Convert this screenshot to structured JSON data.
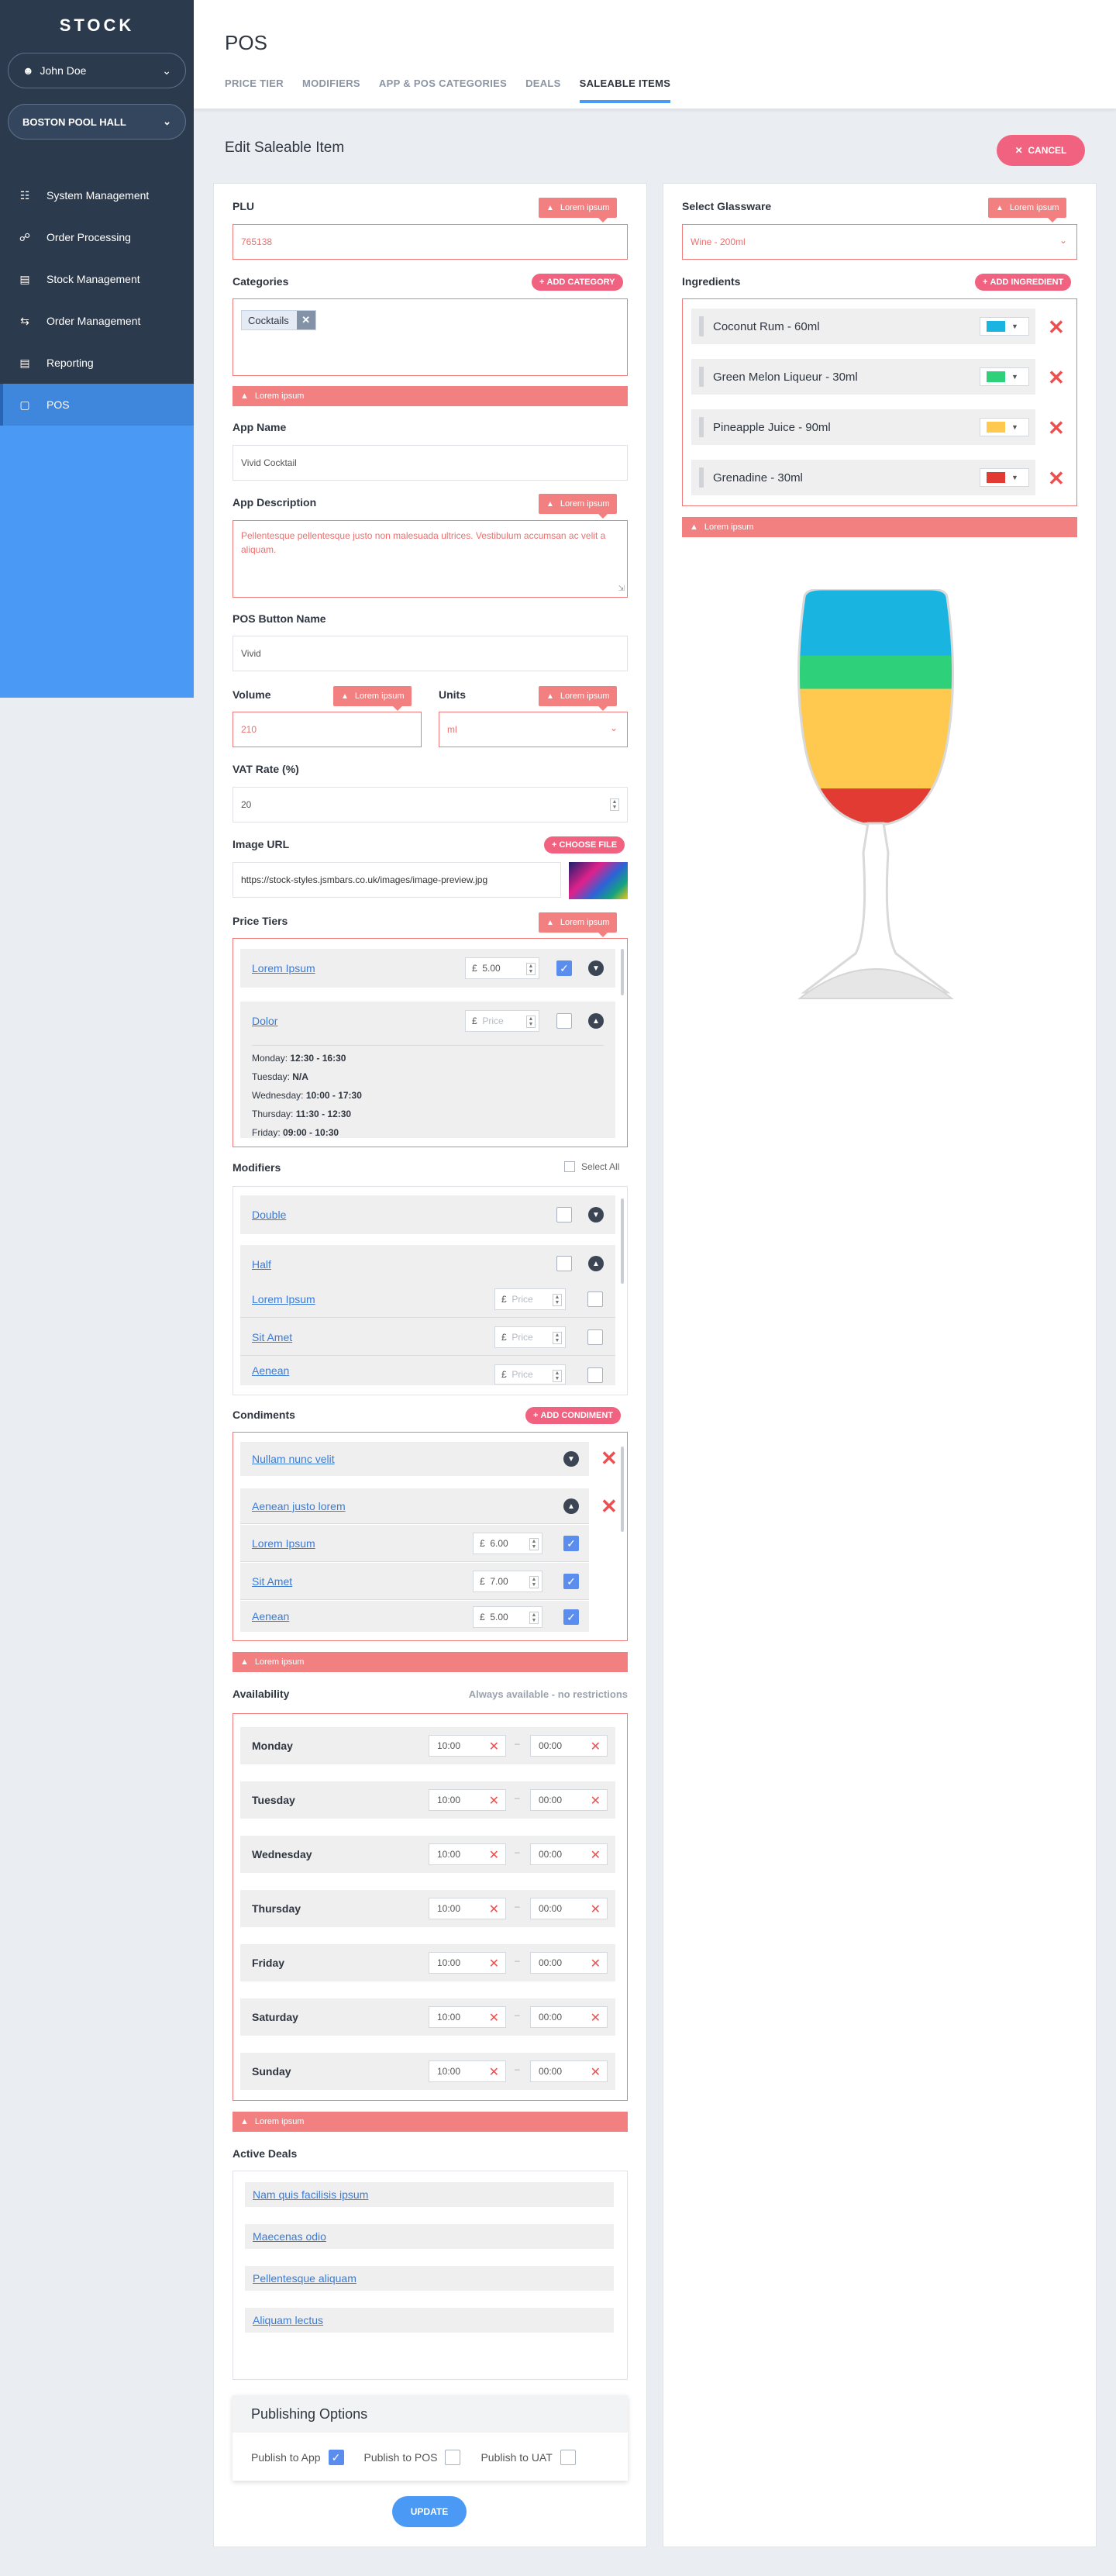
{
  "app": {
    "logo": "STOCK",
    "user": "John Doe",
    "venue": "BOSTON POOL HALL"
  },
  "nav": [
    "System Management",
    "Order Processing",
    "Stock Management",
    "Order Management",
    "Reporting",
    "POS"
  ],
  "header": {
    "title": "POS",
    "tabs": [
      "PRICE TIER",
      "MODIFIERS",
      "APP & POS CATEGORIES",
      "DEALS",
      "SALEABLE ITEMS"
    ]
  },
  "page": {
    "title": "Edit Saleable Item",
    "cancel": "CANCEL",
    "update": "UPDATE"
  },
  "err": "Lorem ipsum",
  "plu": {
    "label": "PLU",
    "value": "765138"
  },
  "categories": {
    "label": "Categories",
    "add": "ADD CATEGORY",
    "chip": "Cocktails"
  },
  "app_name": {
    "label": "App Name",
    "value": "Vivid Cocktail"
  },
  "app_desc": {
    "label": "App Description",
    "value": "Pellentesque pellentesque justo non malesuada ultrices. Vestibulum accumsan ac velit a aliquam."
  },
  "pos_name": {
    "label": "POS Button Name",
    "value": "Vivid"
  },
  "volume": {
    "label": "Volume",
    "value": "210"
  },
  "units": {
    "label": "Units",
    "value": "ml"
  },
  "vat": {
    "label": "VAT Rate (%)",
    "value": "20"
  },
  "image": {
    "label": "Image URL",
    "value": "https://stock-styles.jsmbars.co.uk/images/image-preview.jpg",
    "choose": "CHOOSE FILE"
  },
  "price_tiers": {
    "label": "Price Tiers",
    "rows": [
      {
        "name": "Lorem Ipsum",
        "cur": "£",
        "price": "5.00"
      },
      {
        "name": "Dolor",
        "cur": "£",
        "price": "Price"
      }
    ],
    "schedule": [
      {
        "day": "Monday:",
        "time": "12:30 - 16:30"
      },
      {
        "day": "Tuesday:",
        "time": "N/A"
      },
      {
        "day": "Wednesday:",
        "time": "10:00 - 17:30"
      },
      {
        "day": "Thursday:",
        "time": "11:30 - 12:30"
      },
      {
        "day": "Friday:",
        "time": "09:00 - 10:30"
      }
    ]
  },
  "modifiers": {
    "label": "Modifiers",
    "select_all": "Select All",
    "groups": [
      "Double",
      "Half"
    ],
    "items": [
      {
        "name": "Lorem Ipsum",
        "cur": "£",
        "price": "Price"
      },
      {
        "name": "Sit Amet",
        "cur": "£",
        "price": "Price"
      },
      {
        "name": "Aenean",
        "cur": "£",
        "price": "Price"
      }
    ]
  },
  "condiments": {
    "label": "Condiments",
    "add": "ADD CONDIMENT",
    "groups": [
      "Nullam nunc velit",
      "Aenean justo lorem"
    ],
    "items": [
      {
        "name": "Lorem Ipsum",
        "cur": "£",
        "price": "6.00"
      },
      {
        "name": "Sit Amet",
        "cur": "£",
        "price": "7.00"
      },
      {
        "name": "Aenean",
        "cur": "£",
        "price": "5.00"
      }
    ]
  },
  "availability": {
    "label": "Availability",
    "note": "Always available - no restrictions",
    "days": [
      {
        "day": "Monday",
        "from": "10:00",
        "to": "00:00"
      },
      {
        "day": "Tuesday",
        "from": "10:00",
        "to": "00:00"
      },
      {
        "day": "Wednesday",
        "from": "10:00",
        "to": "00:00"
      },
      {
        "day": "Thursday",
        "from": "10:00",
        "to": "00:00"
      },
      {
        "day": "Friday",
        "from": "10:00",
        "to": "00:00"
      },
      {
        "day": "Saturday",
        "from": "10:00",
        "to": "00:00"
      },
      {
        "day": "Sunday",
        "from": "10:00",
        "to": "00:00"
      }
    ]
  },
  "deals": {
    "label": "Active Deals",
    "items": [
      "Nam quis facilisis ipsum",
      "Maecenas odio",
      "Pellentesque aliquam",
      "Aliquam lectus"
    ]
  },
  "publishing": {
    "title": "Publishing Options",
    "app": "Publish to App",
    "pos": "Publish to POS",
    "uat": "Publish to UAT"
  },
  "glassware": {
    "label": "Select Glassware",
    "value": "Wine - 200ml"
  },
  "ingredients": {
    "label": "Ingredients",
    "add": "ADD INGREDIENT",
    "items": [
      {
        "name": "Coconut Rum - 60ml",
        "color": "#19b4e0"
      },
      {
        "name": "Green Melon Liqueur - 30ml",
        "color": "#2ed17a"
      },
      {
        "name": "Pineapple Juice - 90ml",
        "color": "#fec94e"
      },
      {
        "name": "Grenadine - 30ml",
        "color": "#e13b33"
      }
    ]
  },
  "colors": {
    "accent": "#4a9af5",
    "danger": "#f0627f",
    "sidebar": "#2c3a4d"
  }
}
